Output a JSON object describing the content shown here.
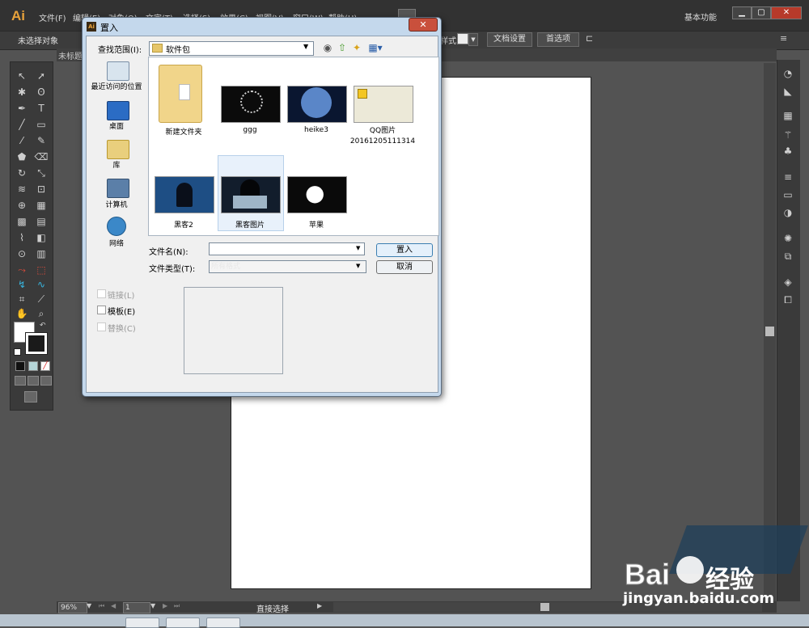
{
  "app": {
    "logo": "Ai",
    "menu": [
      "文件(F)",
      "编辑(E)",
      "对象(O)",
      "文字(T)",
      "选择(S)",
      "效果(C)",
      "视图(V)",
      "窗口(W)",
      "帮助(H)"
    ],
    "workspace": "基本功能",
    "window_buttons": [
      "▁",
      "▢",
      "✕"
    ]
  },
  "control_bar": {
    "selection_status": "未选择对象",
    "style_label": "样式:",
    "doc_setup_button": "文档设置",
    "prefs_button": "首选项"
  },
  "doc_tab": {
    "label": "未标题"
  },
  "status_bar": {
    "zoom": "96%",
    "page": "1",
    "tool_status": "直接选择"
  },
  "dialog": {
    "title": "置入",
    "close": "✕",
    "look_in_label": "查找范围(I):",
    "look_in_value": "软件包",
    "places": [
      {
        "label": "最近访问的位置",
        "icon": "recent-places-icon"
      },
      {
        "label": "桌面",
        "icon": "desktop-icon"
      },
      {
        "label": "库",
        "icon": "libraries-icon"
      },
      {
        "label": "计算机",
        "icon": "computer-icon"
      },
      {
        "label": "网络",
        "icon": "network-icon"
      }
    ],
    "files": [
      {
        "name": "新建文件夹",
        "kind": "folder"
      },
      {
        "name": "ggg",
        "kind": "image"
      },
      {
        "name": "heike3",
        "kind": "image"
      },
      {
        "name": "QQ图片\n20161205111314",
        "kind": "image"
      },
      {
        "name": "黑客2",
        "kind": "image"
      },
      {
        "name": "黑客图片",
        "kind": "image",
        "selected": true
      },
      {
        "name": "苹果",
        "kind": "image"
      }
    ],
    "file_name_label": "文件名(N):",
    "file_name_value": "",
    "file_type_label": "文件类型(T):",
    "file_type_value": "所有格式",
    "place_button": "置入",
    "cancel_button": "取消",
    "options": [
      {
        "label": "链接(L)",
        "checked": false,
        "enabled": false
      },
      {
        "label": "模板(E)",
        "checked": false,
        "enabled": true
      },
      {
        "label": "替换(C)",
        "checked": false,
        "enabled": false
      }
    ]
  },
  "watermark": {
    "brand": "Bai",
    "brand2": "经验",
    "url": "jingyan.baidu.com"
  },
  "colors": {
    "menubar": "#323232",
    "canvas": "#535353",
    "dialog_frame": "#c4d8ec",
    "accent": "#e8a23b"
  }
}
